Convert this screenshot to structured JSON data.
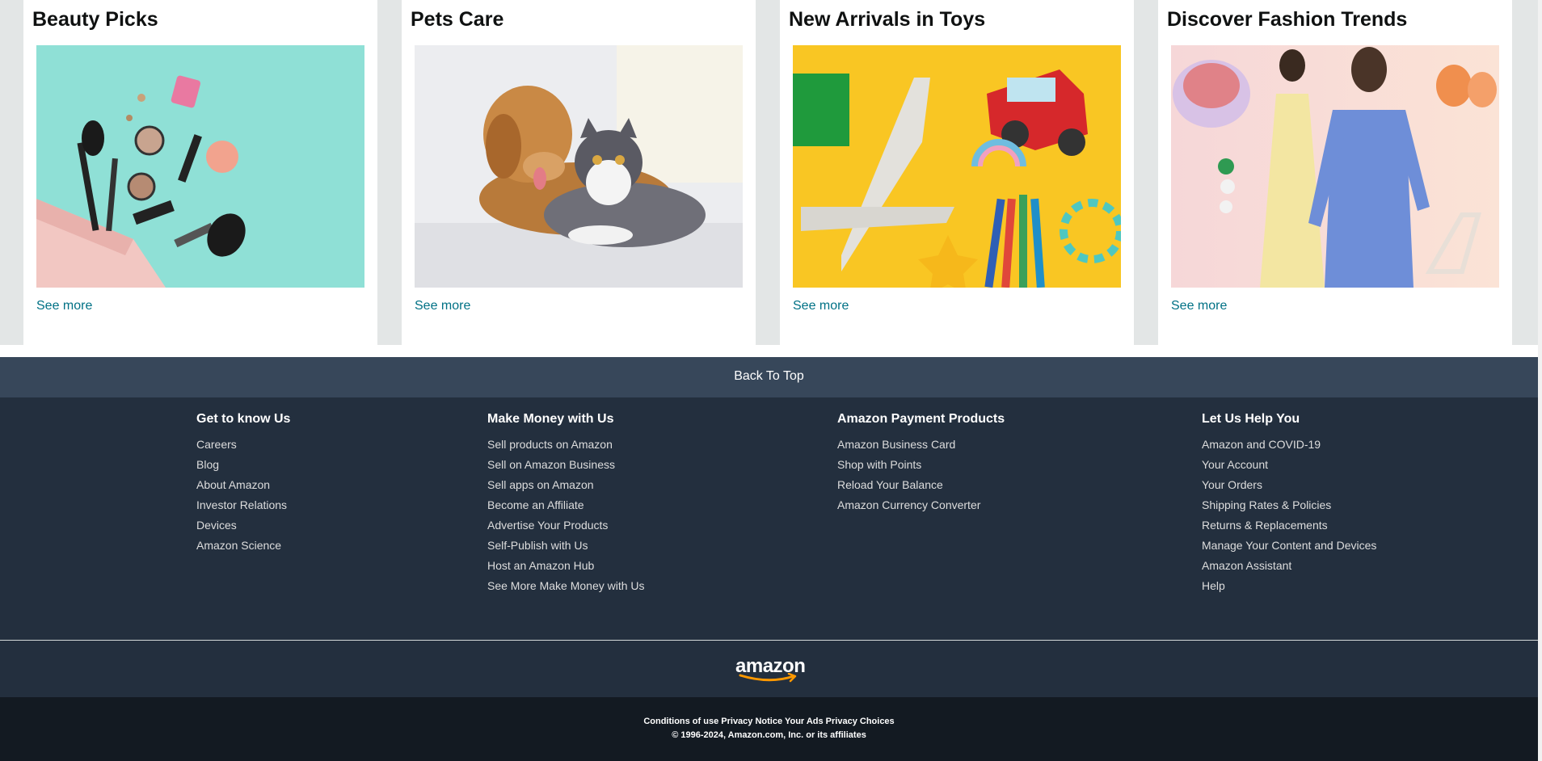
{
  "cards": [
    {
      "title": "Beauty Picks",
      "link": "See more"
    },
    {
      "title": "Pets Care",
      "link": "See more"
    },
    {
      "title": "New Arrivals in Toys",
      "link": "See more"
    },
    {
      "title": "Discover Fashion Trends",
      "link": "See more"
    }
  ],
  "back_to_top": "Back To Top",
  "footer": {
    "columns": [
      {
        "heading": "Get to know Us",
        "links": [
          "Careers",
          "Blog",
          "About Amazon",
          "Investor Relations",
          "Devices",
          "Amazon Science"
        ]
      },
      {
        "heading": "Make Money with Us",
        "links": [
          "Sell products on Amazon",
          "Sell on Amazon Business",
          "Sell apps on Amazon",
          "Become an Affiliate",
          "Advertise Your Products",
          "Self-Publish with Us",
          "Host an Amazon Hub",
          "See More Make Money with Us"
        ]
      },
      {
        "heading": "Amazon Payment Products",
        "links": [
          "Amazon Business Card",
          "Shop with Points",
          "Reload Your Balance",
          "Amazon Currency Converter"
        ]
      },
      {
        "heading": "Let Us Help You",
        "links": [
          "Amazon and COVID-19",
          "Your Account",
          "Your Orders",
          "Shipping Rates & Policies",
          "Returns & Replacements",
          "Manage Your Content and Devices",
          "Amazon Assistant",
          "Help"
        ]
      }
    ],
    "logo_text": "amazon",
    "legal_links": [
      "Conditions of use",
      "Privacy Notice",
      "Your Ads Privacy Choices"
    ],
    "copyright": "© 1996-2024, Amazon.com, Inc. or its affiliates"
  },
  "colors": {
    "link": "#007185",
    "nav_light": "#37475a",
    "nav_dark": "#232f3e",
    "footer_bottom": "#131a22",
    "accent": "#ff9900"
  }
}
